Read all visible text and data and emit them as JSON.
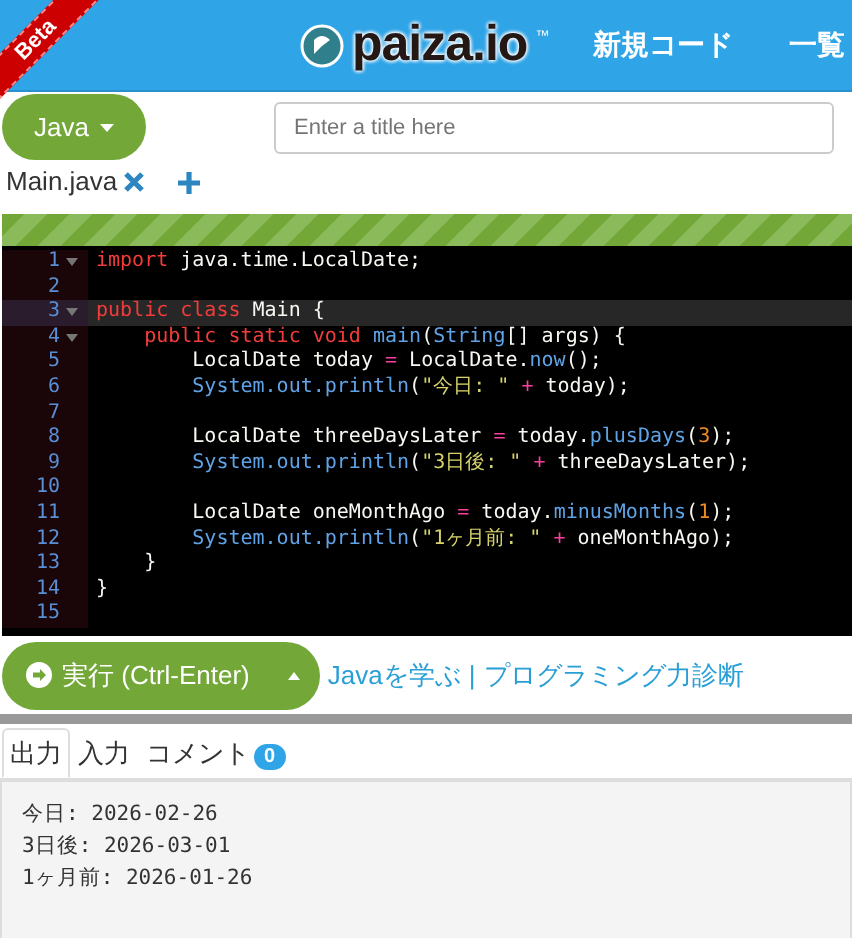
{
  "ribbon": "Beta",
  "header": {
    "logo": "paiza.io",
    "logo_mark": "™",
    "nav": [
      "新規コード",
      "一覧"
    ]
  },
  "language": {
    "label": "Java"
  },
  "title_field": {
    "placeholder": "Enter a title here"
  },
  "files": [
    {
      "name": "Main.java",
      "selected": true
    }
  ],
  "editor": {
    "lines": [
      {
        "number": "1",
        "foldable": true,
        "active": false,
        "tokens": [
          {
            "kind": "kw",
            "text": "import"
          },
          {
            "kind": "plain",
            "text": " java.time.LocalDate;"
          }
        ]
      },
      {
        "number": "2",
        "foldable": false,
        "active": false
      },
      {
        "number": "3",
        "foldable": true,
        "active": true,
        "tokens": [
          {
            "kind": "kw",
            "text": "public class"
          },
          {
            "kind": "plain",
            "text": " Main {"
          }
        ]
      },
      {
        "number": "4",
        "foldable": true,
        "active": false,
        "tokens": [
          {
            "kind": "kw",
            "text": "    public static void"
          },
          {
            "kind": "fn",
            "text": " main"
          },
          {
            "kind": "plain",
            "text": "("
          },
          {
            "kind": "fn",
            "text": "String"
          },
          {
            "kind": "plain",
            "text": "[] args) {"
          }
        ]
      },
      {
        "number": "5",
        "foldable": false,
        "active": false,
        "tokens": [
          {
            "kind": "plain",
            "text": "        LocalDate today "
          },
          {
            "kind": "op",
            "text": "="
          },
          {
            "kind": "plain",
            "text": " LocalDate."
          },
          {
            "kind": "fn",
            "text": "now"
          },
          {
            "kind": "plain",
            "text": "();"
          }
        ]
      },
      {
        "number": "6",
        "foldable": false,
        "active": false,
        "tokens": [
          {
            "kind": "fn",
            "text": "        System.out.println"
          },
          {
            "kind": "plain",
            "text": "("
          },
          {
            "kind": "str",
            "text": "\"今日: \""
          },
          {
            "kind": "op",
            "text": " +"
          },
          {
            "kind": "plain",
            "text": " today);"
          }
        ]
      },
      {
        "number": "7",
        "foldable": false,
        "active": false
      },
      {
        "number": "8",
        "foldable": false,
        "active": false,
        "tokens": [
          {
            "kind": "plain",
            "text": "        LocalDate threeDaysLater "
          },
          {
            "kind": "op",
            "text": "="
          },
          {
            "kind": "plain",
            "text": " today."
          },
          {
            "kind": "fn",
            "text": "plusDays"
          },
          {
            "kind": "plain",
            "text": "("
          },
          {
            "kind": "num",
            "text": "3"
          },
          {
            "kind": "plain",
            "text": ");"
          }
        ]
      },
      {
        "number": "9",
        "foldable": false,
        "active": false,
        "tokens": [
          {
            "kind": "fn",
            "text": "        System.out.println"
          },
          {
            "kind": "plain",
            "text": "("
          },
          {
            "kind": "str",
            "text": "\"3日後: \""
          },
          {
            "kind": "op",
            "text": " +"
          },
          {
            "kind": "plain",
            "text": " threeDaysLater);"
          }
        ]
      },
      {
        "number": "10",
        "foldable": false,
        "active": false
      },
      {
        "number": "11",
        "foldable": false,
        "active": false,
        "tokens": [
          {
            "kind": "plain",
            "text": "        LocalDate oneMonthAgo "
          },
          {
            "kind": "op",
            "text": "="
          },
          {
            "kind": "plain",
            "text": " today."
          },
          {
            "kind": "fn",
            "text": "minusMonths"
          },
          {
            "kind": "plain",
            "text": "("
          },
          {
            "kind": "num",
            "text": "1"
          },
          {
            "kind": "plain",
            "text": ");"
          }
        ]
      },
      {
        "number": "12",
        "foldable": false,
        "active": false,
        "tokens": [
          {
            "kind": "fn",
            "text": "        System.out.println"
          },
          {
            "kind": "plain",
            "text": "("
          },
          {
            "kind": "str",
            "text": "\"1ヶ月前: \""
          },
          {
            "kind": "op",
            "text": " +"
          },
          {
            "kind": "plain",
            "text": " oneMonthAgo);"
          }
        ]
      },
      {
        "number": "13",
        "foldable": false,
        "active": false,
        "tokens": [
          {
            "kind": "plain",
            "text": "    }"
          }
        ]
      },
      {
        "number": "14",
        "foldable": false,
        "active": false,
        "tokens": [
          {
            "kind": "plain",
            "text": "}"
          }
        ]
      },
      {
        "number": "15",
        "foldable": false,
        "active": false
      }
    ]
  },
  "run_button": {
    "label": "実行 (Ctrl-Enter)"
  },
  "links": [
    {
      "text": "Javaを学ぶ"
    },
    {
      "text": "プログラミング力診断"
    }
  ],
  "link_separator": "|",
  "output_tabs": [
    {
      "label": "出力",
      "selected": true
    },
    {
      "label": "入力",
      "selected": false
    },
    {
      "label": "コメント",
      "selected": false,
      "badge": "0"
    }
  ],
  "output": [
    "今日: 2026-02-26",
    "3日後: 2026-03-01",
    "1ヶ月前: 2026-01-26"
  ]
}
